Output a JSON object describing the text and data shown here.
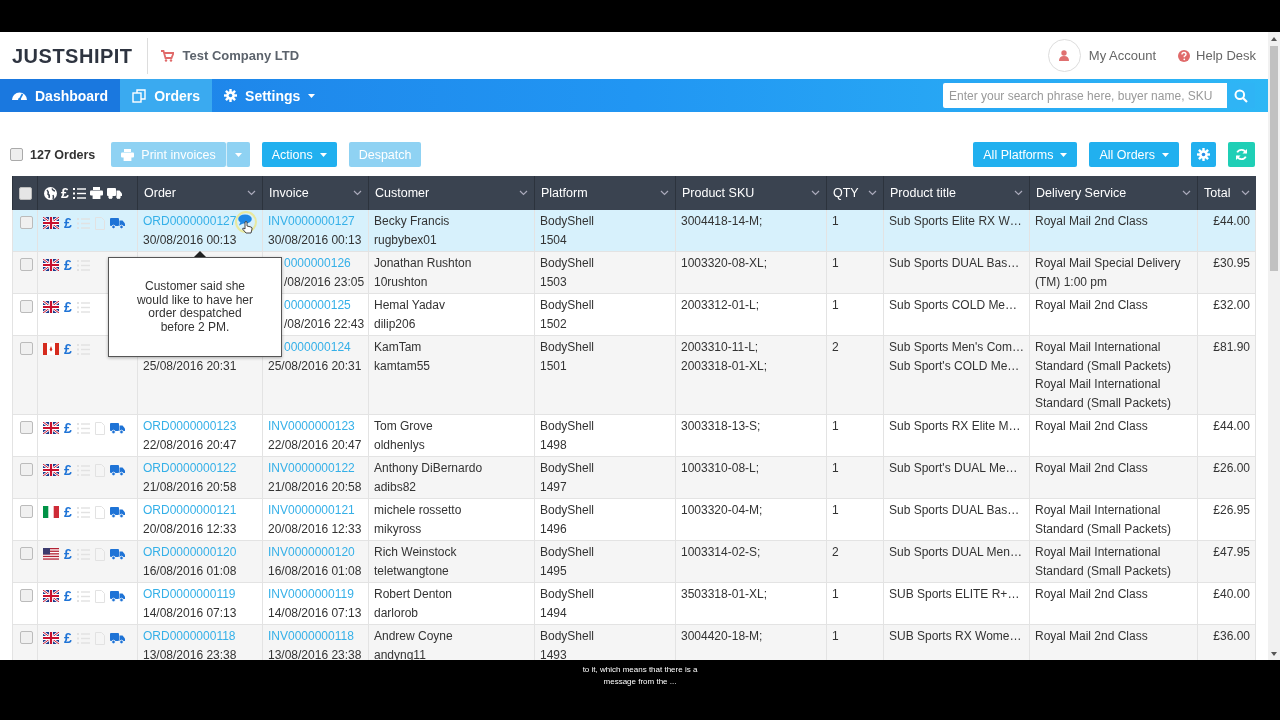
{
  "header": {
    "logo": "JUSTSHIPIT",
    "company": "Test Company LTD",
    "account": "My Account",
    "help": "Help Desk"
  },
  "nav": {
    "items": [
      {
        "label": "Dashboard",
        "selected": false,
        "dropdown": false
      },
      {
        "label": "Orders",
        "selected": true,
        "dropdown": false
      },
      {
        "label": "Settings",
        "selected": false,
        "dropdown": true
      }
    ],
    "search": {
      "placeholder": "Enter your search phrase here, buyer name, SKU"
    }
  },
  "toolbar": {
    "count": "127 Orders",
    "checked": false,
    "buttons": [
      {
        "label": "Print invoices",
        "kind": "split",
        "disabled": true
      },
      {
        "label": "Actions",
        "kind": "dropdown",
        "disabled": false
      },
      {
        "label": "Despatch",
        "kind": "plain",
        "disabled": true
      }
    ],
    "filters": [
      "All Platforms",
      "All Orders"
    ]
  },
  "table": {
    "all_checked": false,
    "currency_header": "£",
    "columns": [
      "Order",
      "Invoice",
      "Customer",
      "Platform",
      "Product SKU",
      "QTY",
      "Product title",
      "Delivery Service",
      "Total"
    ],
    "rows": [
      {
        "selected": true,
        "kind": "uk",
        "currency": "£",
        "has_message": true,
        "order_id": "ORD0000000127",
        "order_date": "30/08/2016 00:13",
        "invoice_id": "INV0000000127",
        "invoice_date": "30/08/2016 00:13",
        "customer": "Becky Francis",
        "username": "rugbybex01",
        "platform": "BodyShell",
        "platform_ref": "1504",
        "skus": [
          "3004418-14-M;"
        ],
        "qty": "1",
        "titles": [
          "Sub Sports Elite RX W…"
        ],
        "delivery": [
          "Royal Mail 2nd Class"
        ],
        "total": "£44.00"
      },
      {
        "selected": false,
        "kind": "uk",
        "currency": "£",
        "has_message": false,
        "invoice_id": "0000000126",
        "invoice_date": "/08/2016 23:05",
        "customer": "Jonathan Rushton",
        "username": "10rushton",
        "platform": "BodyShell",
        "platform_ref": "1503",
        "skus": [
          "1003320-08-XL;"
        ],
        "qty": "1",
        "titles": [
          "Sub Sports DUAL Bas…"
        ],
        "delivery": [
          "Royal Mail Special Delivery (TM) 1:00 pm"
        ],
        "total": "£30.95"
      },
      {
        "selected": false,
        "kind": "uk",
        "currency": "£",
        "has_message": false,
        "invoice_id": "0000000125",
        "invoice_date": "/08/2016 22:43",
        "customer": "Hemal Yadav",
        "username": "dilip206",
        "platform": "BodyShell",
        "platform_ref": "1502",
        "skus": [
          "2003312-01-L;"
        ],
        "qty": "1",
        "titles": [
          "Sub Sports COLD Me…"
        ],
        "delivery": [
          "Royal Mail 2nd Class"
        ],
        "total": "£32.00"
      },
      {
        "selected": false,
        "kind": "ca",
        "currency": "£",
        "has_message": false,
        "order_date": "25/08/2016 20:31",
        "invoice_id": "0000000124",
        "invoice_date": "25/08/2016 20:31",
        "customer": "KamTam",
        "username": "kamtam55",
        "platform": "BodyShell",
        "platform_ref": "1501",
        "skus": [
          "2003310-11-L;",
          "2003318-01-XL;"
        ],
        "qty": "2",
        "titles": [
          "Sub Sports Men's Com…",
          "Sub Sport's COLD Me…"
        ],
        "delivery": [
          "Royal Mail International Standard (Small Packets)",
          "Royal Mail International Standard (Small Packets)"
        ],
        "total": "£81.90"
      },
      {
        "selected": false,
        "kind": "uk",
        "currency": "£",
        "has_message": false,
        "order_id": "ORD0000000123",
        "order_date": "22/08/2016 20:47",
        "invoice_id": "INV0000000123",
        "invoice_date": "22/08/2016 20:47",
        "customer": "Tom Grove",
        "username": "oldhenlys",
        "platform": "BodyShell",
        "platform_ref": "1498",
        "skus": [
          "3003318-13-S;"
        ],
        "qty": "1",
        "titles": [
          "Sub Sports RX Elite M…"
        ],
        "delivery": [
          "Royal Mail 2nd Class"
        ],
        "total": "£44.00"
      },
      {
        "selected": false,
        "kind": "uk",
        "currency": "£",
        "has_message": false,
        "order_id": "ORD0000000122",
        "order_date": "21/08/2016 20:58",
        "invoice_id": "INV0000000122",
        "invoice_date": "21/08/2016 20:58",
        "customer": "Anthony DiBernardo",
        "username": "adibs82",
        "platform": "BodyShell",
        "platform_ref": "1497",
        "skus": [
          "1003310-08-L;"
        ],
        "qty": "1",
        "titles": [
          "Sub Sport's DUAL Me…"
        ],
        "delivery": [
          "Royal Mail 2nd Class"
        ],
        "total": "£26.00"
      },
      {
        "selected": false,
        "kind": "it",
        "currency": "£",
        "has_message": false,
        "order_id": "ORD0000000121",
        "order_date": "20/08/2016 12:33",
        "invoice_id": "INV0000000121",
        "invoice_date": "20/08/2016 12:33",
        "customer": "michele rossetto",
        "username": "mikyross",
        "platform": "BodyShell",
        "platform_ref": "1496",
        "skus": [
          "1003320-04-M;"
        ],
        "qty": "1",
        "titles": [
          "Sub Sports DUAL Bas…"
        ],
        "delivery": [
          "Royal Mail International Standard (Small Packets)"
        ],
        "total": "£26.95"
      },
      {
        "selected": false,
        "kind": "us",
        "currency": "£",
        "has_message": false,
        "order_id": "ORD0000000120",
        "order_date": "16/08/2016 01:08",
        "invoice_id": "INV0000000120",
        "invoice_date": "16/08/2016 01:08",
        "customer": "Rich Weinstock",
        "username": "teletwangtone",
        "platform": "BodyShell",
        "platform_ref": "1495",
        "skus": [
          "1003314-02-S;"
        ],
        "qty": "2",
        "titles": [
          "Sub Sports DUAL Men…"
        ],
        "delivery": [
          "Royal Mail International Standard (Small Packets)"
        ],
        "total": "£47.95"
      },
      {
        "selected": false,
        "kind": "uk",
        "currency": "£",
        "has_message": false,
        "order_id": "ORD0000000119",
        "order_date": "14/08/2016 07:13",
        "invoice_id": "INV0000000119",
        "invoice_date": "14/08/2016 07:13",
        "customer": "Robert Denton",
        "username": "darlorob",
        "platform": "BodyShell",
        "platform_ref": "1494",
        "skus": [
          "3503318-01-XL;"
        ],
        "qty": "1",
        "titles": [
          "SUB Sports ELITE R+…"
        ],
        "delivery": [
          "Royal Mail 2nd Class"
        ],
        "total": "£40.00"
      },
      {
        "selected": false,
        "kind": "uk",
        "currency": "£",
        "has_message": false,
        "order_id": "ORD0000000118",
        "order_date": "13/08/2016 23:38",
        "invoice_id": "INV0000000118",
        "invoice_date": "13/08/2016 23:38",
        "customer": "Andrew Coyne",
        "username": "andyng11",
        "platform": "BodyShell",
        "platform_ref": "1493",
        "skus": [
          "3004420-18-M;"
        ],
        "qty": "1",
        "titles": [
          "SUB Sports RX Wome…"
        ],
        "delivery": [
          "Royal Mail 2nd Class"
        ],
        "total": "£36.00"
      }
    ],
    "tooltip": "Customer said she would like to have her order despatched before 2 PM."
  },
  "caption": [
    "to it, which means that there is a",
    "message from the ..."
  ]
}
